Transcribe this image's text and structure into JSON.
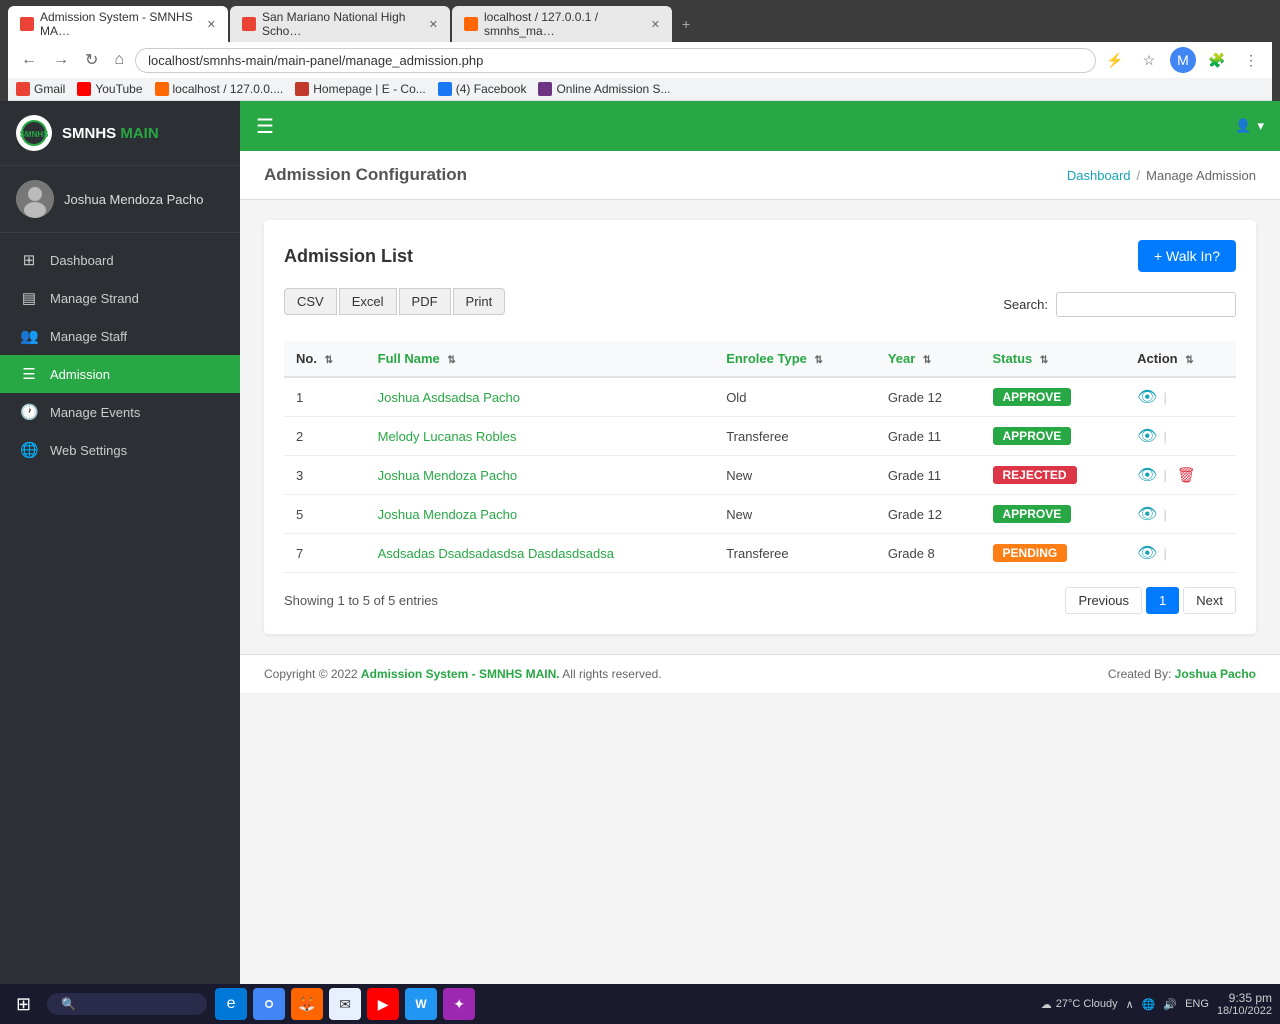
{
  "browser": {
    "tabs": [
      {
        "label": "Admission System - SMNHS MA…",
        "active": true,
        "icon_color": "#4285f4"
      },
      {
        "label": "San Mariano National High Scho…",
        "active": false,
        "icon_color": "#4285f4"
      },
      {
        "label": "localhost / 127.0.0.1 / smnhs_ma…",
        "active": false,
        "icon_color": "#ff6600"
      }
    ],
    "address": "localhost/smnhs-main/main-panel/manage_admission.php",
    "bookmarks": [
      {
        "label": "Gmail",
        "icon_class": "bm-gmail"
      },
      {
        "label": "YouTube",
        "icon_class": "bm-youtube"
      },
      {
        "label": "localhost / 127.0.0....",
        "icon_class": "bm-localhost"
      },
      {
        "label": "Homepage | E - Co...",
        "icon_class": "bm-homepage"
      },
      {
        "label": "(4) Facebook",
        "icon_class": "bm-facebook"
      },
      {
        "label": "Online Admission S...",
        "icon_class": "bm-online"
      }
    ]
  },
  "sidebar": {
    "brand": "SMNHS MAIN",
    "brand_prefix": "SMNHS",
    "brand_suffix": " MAIN",
    "user_name": "Joshua Mendoza Pacho",
    "nav_items": [
      {
        "label": "Dashboard",
        "icon": "⊞",
        "active": false
      },
      {
        "label": "Manage Strand",
        "icon": "▤",
        "active": false
      },
      {
        "label": "Manage Staff",
        "icon": "👥",
        "active": false
      },
      {
        "label": "Admission",
        "icon": "☰",
        "active": true
      },
      {
        "label": "Manage Events",
        "icon": "🕐",
        "active": false
      },
      {
        "label": "Web Settings",
        "icon": "🌐",
        "active": false
      }
    ]
  },
  "topbar": {
    "user_label": "▾"
  },
  "page": {
    "config_title": "Admission Configuration",
    "breadcrumb_home": "Dashboard",
    "breadcrumb_current": "Manage Admission",
    "list_title": "Admission List",
    "walk_in_btn": "+ Walk In?"
  },
  "export_buttons": [
    "CSV",
    "Excel",
    "PDF",
    "Print"
  ],
  "search": {
    "label": "Search:",
    "placeholder": ""
  },
  "table": {
    "columns": [
      "No.",
      "Full Name",
      "Enrolee Type",
      "Year",
      "Status",
      "Action"
    ],
    "rows": [
      {
        "no": "1",
        "full_name": "Joshua Asdsadsa Pacho",
        "enrolee_type": "Old",
        "year": "Grade 12",
        "status": "APPROVE",
        "status_class": "status-approve"
      },
      {
        "no": "2",
        "full_name": "Melody Lucanas Robles",
        "enrolee_type": "Transferee",
        "year": "Grade 11",
        "status": "APPROVE",
        "status_class": "status-approve"
      },
      {
        "no": "3",
        "full_name": "Joshua Mendoza Pacho",
        "enrolee_type": "New",
        "year": "Grade 11",
        "status": "REJECTED",
        "status_class": "status-rejected"
      },
      {
        "no": "5",
        "full_name": "Joshua Mendoza Pacho",
        "enrolee_type": "New",
        "year": "Grade 12",
        "status": "APPROVE",
        "status_class": "status-approve"
      },
      {
        "no": "7",
        "full_name": "Asdsadas Dsadsadasdsa Dasdasdsadsa",
        "enrolee_type": "Transferee",
        "year": "Grade 8",
        "status": "PENDING",
        "status_class": "status-pending"
      }
    ],
    "showing_text": "Showing 1 to 5 of 5 entries"
  },
  "pagination": {
    "prev_label": "Previous",
    "next_label": "Next",
    "current_page": "1"
  },
  "footer": {
    "copyright": "Copyright © 2022",
    "app_name": "Admission System - SMNHS MAIN.",
    "rights": " All rights reserved.",
    "created_by_label": "Created By:",
    "created_by_name": "Joshua Pacho"
  },
  "taskbar": {
    "weather": "27°C  Cloudy",
    "time": "9:35 pm",
    "date": "18/10/2022",
    "language": "ENG"
  }
}
